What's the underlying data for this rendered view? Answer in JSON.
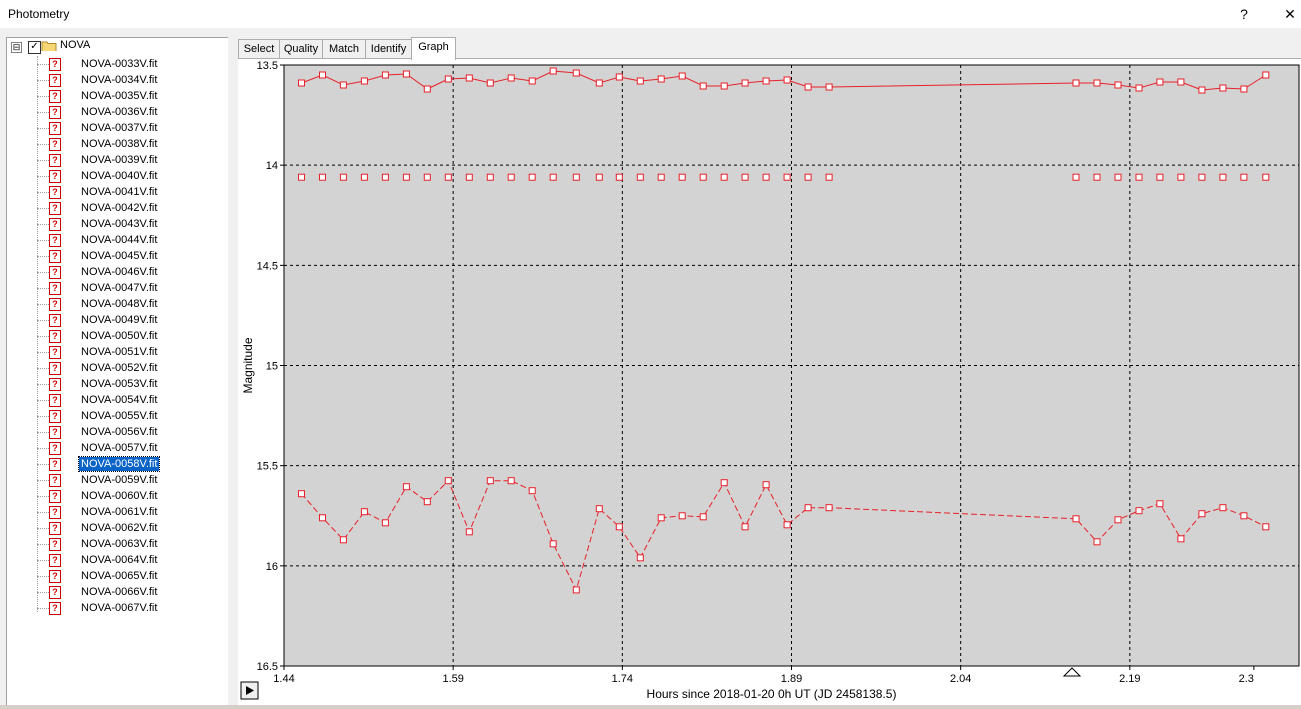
{
  "window": {
    "title": "Photometry",
    "help_label": "?",
    "close_label": "✕"
  },
  "tree": {
    "root_label": "NOVA",
    "root_expander": "⊟",
    "root_checked": "✓",
    "item_icon": "question-file-icon",
    "items": [
      "NOVA-0033V.fit",
      "NOVA-0034V.fit",
      "NOVA-0035V.fit",
      "NOVA-0036V.fit",
      "NOVA-0037V.fit",
      "NOVA-0038V.fit",
      "NOVA-0039V.fit",
      "NOVA-0040V.fit",
      "NOVA-0041V.fit",
      "NOVA-0042V.fit",
      "NOVA-0043V.fit",
      "NOVA-0044V.fit",
      "NOVA-0045V.fit",
      "NOVA-0046V.fit",
      "NOVA-0047V.fit",
      "NOVA-0048V.fit",
      "NOVA-0049V.fit",
      "NOVA-0050V.fit",
      "NOVA-0051V.fit",
      "NOVA-0052V.fit",
      "NOVA-0053V.fit",
      "NOVA-0054V.fit",
      "NOVA-0055V.fit",
      "NOVA-0056V.fit",
      "NOVA-0057V.fit",
      "NOVA-0058V.fit",
      "NOVA-0059V.fit",
      "NOVA-0060V.fit",
      "NOVA-0061V.fit",
      "NOVA-0062V.fit",
      "NOVA-0063V.fit",
      "NOVA-0064V.fit",
      "NOVA-0065V.fit",
      "NOVA-0066V.fit",
      "NOVA-0067V.fit"
    ],
    "selected": "NOVA-0058V.fit"
  },
  "tabs": [
    "Select",
    "Quality",
    "Match",
    "Identify",
    "Graph"
  ],
  "active_tab": "Graph",
  "play_button": "▶",
  "chart_data": {
    "type": "scatter",
    "xlabel": "Hours since 2018-01-20 0h UT (JD 2458138.5)",
    "ylabel": "Magnitude",
    "xlim": [
      1.44,
      2.34
    ],
    "ylim": [
      16.5,
      13.5
    ],
    "y_inverted": true,
    "xticks": [
      "1.44",
      "1.59",
      "1.74",
      "1.89",
      "2.04",
      "2.19",
      "2.3"
    ],
    "yticks": [
      "13.5",
      "14",
      "14.5",
      "15",
      "15.5",
      "16",
      "16.5"
    ],
    "grid": true,
    "plot_bg": "#d3d3d3",
    "series_color": "#e8202a",
    "marker": "square",
    "series": [
      {
        "line": "solid",
        "x": [
          1.4555,
          1.4741,
          1.4927,
          1.5113,
          1.5299,
          1.5485,
          1.5671,
          1.5857,
          1.6043,
          1.6229,
          1.6415,
          1.6601,
          1.6787,
          1.6992,
          1.7196,
          1.7373,
          1.7559,
          1.7745,
          1.7931,
          1.8117,
          1.8303,
          1.8489,
          1.8675,
          1.8861,
          1.9047,
          1.9233,
          2.1423,
          2.1609,
          2.1795,
          2.1981,
          2.2167,
          2.2353,
          2.2539,
          2.2725,
          2.2911,
          2.3106
        ],
        "y": [
          13.59,
          13.55,
          13.6,
          13.58,
          13.55,
          13.545,
          13.62,
          13.57,
          13.565,
          13.59,
          13.565,
          13.58,
          13.53,
          13.54,
          13.59,
          13.56,
          13.58,
          13.57,
          13.555,
          13.605,
          13.605,
          13.59,
          13.58,
          13.575,
          13.61,
          13.61,
          13.59,
          13.59,
          13.6,
          13.615,
          13.585,
          13.585,
          13.625,
          13.615,
          13.62,
          13.55
        ]
      },
      {
        "line": "none",
        "x": [
          1.4555,
          1.4741,
          1.4927,
          1.5113,
          1.5299,
          1.5485,
          1.5671,
          1.5857,
          1.6043,
          1.6229,
          1.6415,
          1.6601,
          1.6787,
          1.6992,
          1.7196,
          1.7373,
          1.7559,
          1.7745,
          1.7931,
          1.8117,
          1.8303,
          1.8489,
          1.8675,
          1.8861,
          1.9047,
          1.9233,
          2.1423,
          2.1609,
          2.1795,
          2.1981,
          2.2167,
          2.2353,
          2.2539,
          2.2725,
          2.2911,
          2.3106
        ],
        "y": [
          14.06,
          14.06,
          14.06,
          14.06,
          14.06,
          14.06,
          14.06,
          14.06,
          14.06,
          14.06,
          14.06,
          14.06,
          14.06,
          14.06,
          14.06,
          14.06,
          14.06,
          14.06,
          14.06,
          14.06,
          14.06,
          14.06,
          14.06,
          14.06,
          14.06,
          14.06,
          14.06,
          14.06,
          14.06,
          14.06,
          14.06,
          14.06,
          14.06,
          14.06,
          14.06,
          14.06
        ]
      },
      {
        "line": "dashed",
        "x": [
          1.4555,
          1.4741,
          1.4927,
          1.5113,
          1.5299,
          1.5485,
          1.5671,
          1.5857,
          1.6043,
          1.6229,
          1.6415,
          1.6601,
          1.6787,
          1.6992,
          1.7196,
          1.7373,
          1.7559,
          1.7745,
          1.7931,
          1.8117,
          1.8303,
          1.8489,
          1.8675,
          1.8861,
          1.9047,
          1.9233,
          2.1423,
          2.1609,
          2.1795,
          2.1981,
          2.2167,
          2.2353,
          2.2539,
          2.2725,
          2.2911,
          2.3106
        ],
        "y": [
          15.64,
          15.76,
          15.87,
          15.73,
          15.785,
          15.605,
          15.68,
          15.575,
          15.83,
          15.575,
          15.575,
          15.625,
          15.89,
          16.12,
          15.715,
          15.805,
          15.96,
          15.76,
          15.75,
          15.755,
          15.585,
          15.805,
          15.595,
          15.795,
          15.71,
          15.71,
          15.765,
          15.88,
          15.77,
          15.725,
          15.69,
          15.865,
          15.74,
          15.71,
          15.75,
          15.805
        ]
      }
    ]
  }
}
